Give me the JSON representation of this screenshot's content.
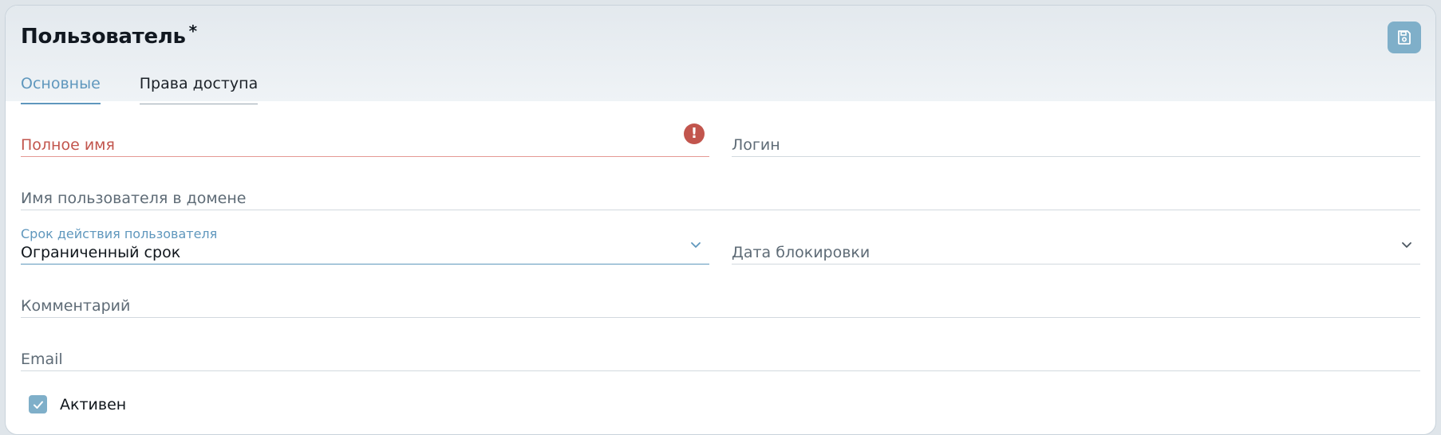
{
  "header": {
    "title": "Пользователь",
    "required_mark": "*",
    "save_icon": "floppy-disk-icon",
    "accent": "#7fafc9"
  },
  "tabs": [
    {
      "label": "Основные",
      "active": true
    },
    {
      "label": "Права доступа",
      "active": false
    }
  ],
  "fields": {
    "full_name": {
      "placeholder": "Полное имя",
      "value": "",
      "error": true,
      "error_glyph": "!"
    },
    "login": {
      "placeholder": "Логин",
      "value": ""
    },
    "domain_username": {
      "placeholder": "Имя пользователя в домене",
      "value": ""
    },
    "validity": {
      "label": "Срок действия пользователя",
      "value": "Ограниченный срок"
    },
    "block_date": {
      "placeholder": "Дата блокировки",
      "value": ""
    },
    "comment": {
      "placeholder": "Комментарий",
      "value": ""
    },
    "email": {
      "placeholder": "Email",
      "value": ""
    }
  },
  "active_checkbox": {
    "label": "Активен",
    "checked": true
  },
  "colors": {
    "accent": "#5f97bd",
    "error": "#c2554d",
    "checkbox": "#7fafc9"
  }
}
